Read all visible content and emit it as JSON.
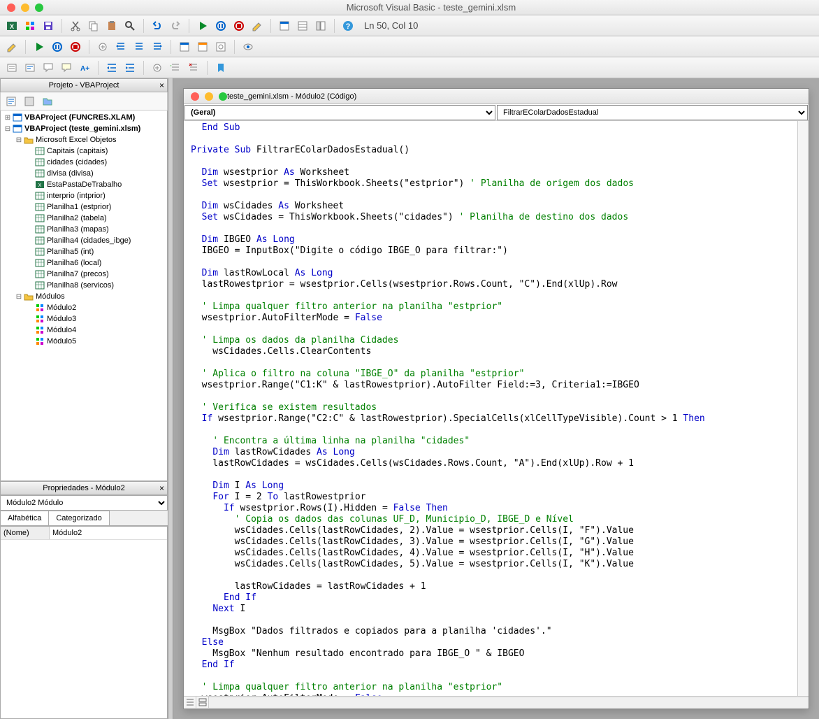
{
  "window_title": "Microsoft Visual Basic - teste_gemini.xlsm",
  "status": "Ln 50, Col 10",
  "project_panel_title": "Projeto - VBAProject",
  "properties_panel_title": "Propriedades - Módulo2",
  "prop_select": "Módulo2 Módulo",
  "prop_tab1": "Alfabética",
  "prop_tab2": "Categorizado",
  "prop_name_label": "(Nome)",
  "prop_name_value": "Módulo2",
  "code_window_title": "teste_gemini.xlsm - Módulo2 (Código)",
  "object_select": "(Geral)",
  "proc_select": "FiltrarEColarDadosEstadual",
  "tree": [
    {
      "d": 0,
      "t": "+",
      "icon": "proj",
      "b": true,
      "label": "VBAProject (FUNCRES.XLAM)"
    },
    {
      "d": 0,
      "t": "-",
      "icon": "proj",
      "b": true,
      "label": "VBAProject (teste_gemini.xlsm)"
    },
    {
      "d": 1,
      "t": "-",
      "icon": "folder",
      "label": "Microsoft Excel Objetos"
    },
    {
      "d": 2,
      "t": "",
      "icon": "sheet",
      "label": "Capitais (capitais)"
    },
    {
      "d": 2,
      "t": "",
      "icon": "sheet",
      "label": "cidades (cidades)"
    },
    {
      "d": 2,
      "t": "",
      "icon": "sheet",
      "label": "divisa (divisa)"
    },
    {
      "d": 2,
      "t": "",
      "icon": "wb",
      "label": "EstaPastaDeTrabalho"
    },
    {
      "d": 2,
      "t": "",
      "icon": "sheet",
      "label": "interprio (intprior)"
    },
    {
      "d": 2,
      "t": "",
      "icon": "sheet",
      "label": "Planilha1 (estprior)"
    },
    {
      "d": 2,
      "t": "",
      "icon": "sheet",
      "label": "Planilha2 (tabela)"
    },
    {
      "d": 2,
      "t": "",
      "icon": "sheet",
      "label": "Planilha3 (mapas)"
    },
    {
      "d": 2,
      "t": "",
      "icon": "sheet",
      "label": "Planilha4 (cidades_ibge)"
    },
    {
      "d": 2,
      "t": "",
      "icon": "sheet",
      "label": "Planilha5 (int)"
    },
    {
      "d": 2,
      "t": "",
      "icon": "sheet",
      "label": "Planilha6 (local)"
    },
    {
      "d": 2,
      "t": "",
      "icon": "sheet",
      "label": "Planilha7 (precos)"
    },
    {
      "d": 2,
      "t": "",
      "icon": "sheet",
      "label": "Planilha8 (servicos)"
    },
    {
      "d": 1,
      "t": "-",
      "icon": "folder",
      "label": "Módulos"
    },
    {
      "d": 2,
      "t": "",
      "icon": "mod",
      "label": "Módulo2"
    },
    {
      "d": 2,
      "t": "",
      "icon": "mod",
      "label": "Módulo3"
    },
    {
      "d": 2,
      "t": "",
      "icon": "mod",
      "label": "Módulo4"
    },
    {
      "d": 2,
      "t": "",
      "icon": "mod",
      "label": "Módulo5"
    }
  ],
  "code_lines": [
    {
      "i": 1,
      "seg": [
        {
          "t": "End Sub",
          "c": "kw"
        }
      ]
    },
    {
      "i": 0,
      "seg": [
        {
          "t": "",
          "c": ""
        }
      ]
    },
    {
      "i": 0,
      "seg": [
        {
          "t": "Private Sub ",
          "c": "kw"
        },
        {
          "t": "FiltrarEColarDadosEstadual()",
          "c": ""
        }
      ]
    },
    {
      "i": 0,
      "seg": [
        {
          "t": "",
          "c": ""
        }
      ]
    },
    {
      "i": 1,
      "seg": [
        {
          "t": "Dim ",
          "c": "kw"
        },
        {
          "t": "wsestprior ",
          "c": ""
        },
        {
          "t": "As ",
          "c": "kw"
        },
        {
          "t": "Worksheet",
          "c": ""
        }
      ]
    },
    {
      "i": 1,
      "seg": [
        {
          "t": "Set ",
          "c": "kw"
        },
        {
          "t": "wsestprior = ThisWorkbook.Sheets(\"estprior\") ",
          "c": ""
        },
        {
          "t": "' Planilha de origem dos dados",
          "c": "cm"
        }
      ]
    },
    {
      "i": 0,
      "seg": [
        {
          "t": "",
          "c": ""
        }
      ]
    },
    {
      "i": 1,
      "seg": [
        {
          "t": "Dim ",
          "c": "kw"
        },
        {
          "t": "wsCidades ",
          "c": ""
        },
        {
          "t": "As ",
          "c": "kw"
        },
        {
          "t": "Worksheet",
          "c": ""
        }
      ]
    },
    {
      "i": 1,
      "seg": [
        {
          "t": "Set ",
          "c": "kw"
        },
        {
          "t": "wsCidades = ThisWorkbook.Sheets(\"cidades\") ",
          "c": ""
        },
        {
          "t": "' Planilha de destino dos dados",
          "c": "cm"
        }
      ]
    },
    {
      "i": 0,
      "seg": [
        {
          "t": "",
          "c": ""
        }
      ]
    },
    {
      "i": 1,
      "seg": [
        {
          "t": "Dim ",
          "c": "kw"
        },
        {
          "t": "IBGEO ",
          "c": ""
        },
        {
          "t": "As Long",
          "c": "kw"
        }
      ]
    },
    {
      "i": 1,
      "seg": [
        {
          "t": "IBGEO = InputBox(\"Digite o código IBGE_O para filtrar:\")",
          "c": ""
        }
      ]
    },
    {
      "i": 0,
      "seg": [
        {
          "t": "",
          "c": ""
        }
      ]
    },
    {
      "i": 1,
      "seg": [
        {
          "t": "Dim ",
          "c": "kw"
        },
        {
          "t": "lastRowLocal ",
          "c": ""
        },
        {
          "t": "As Long",
          "c": "kw"
        }
      ]
    },
    {
      "i": 1,
      "seg": [
        {
          "t": "lastRowestprior = wsestprior.Cells(wsestprior.Rows.Count, \"C\").End(xlUp).Row",
          "c": ""
        }
      ]
    },
    {
      "i": 0,
      "seg": [
        {
          "t": "",
          "c": ""
        }
      ]
    },
    {
      "i": 1,
      "seg": [
        {
          "t": "' Limpa qualquer filtro anterior na planilha \"estprior\"",
          "c": "cm"
        }
      ]
    },
    {
      "i": 1,
      "seg": [
        {
          "t": "wsestprior.AutoFilterMode = ",
          "c": ""
        },
        {
          "t": "False",
          "c": "kw"
        }
      ]
    },
    {
      "i": 0,
      "seg": [
        {
          "t": "",
          "c": ""
        }
      ]
    },
    {
      "i": 1,
      "seg": [
        {
          "t": "' Limpa os dados da planilha Cidades",
          "c": "cm"
        }
      ]
    },
    {
      "i": 2,
      "seg": [
        {
          "t": "wsCidades.Cells.ClearContents",
          "c": ""
        }
      ]
    },
    {
      "i": 0,
      "seg": [
        {
          "t": "",
          "c": ""
        }
      ]
    },
    {
      "i": 1,
      "seg": [
        {
          "t": "' Aplica o filtro na coluna \"IBGE_O\" da planilha \"estprior\"",
          "c": "cm"
        }
      ]
    },
    {
      "i": 1,
      "seg": [
        {
          "t": "wsestprior.Range(\"C1:K\" & lastRowestprior).AutoFilter Field:=3, Criteria1:=IBGEO",
          "c": ""
        }
      ]
    },
    {
      "i": 0,
      "seg": [
        {
          "t": "",
          "c": ""
        }
      ]
    },
    {
      "i": 1,
      "seg": [
        {
          "t": "' Verifica se existem resultados",
          "c": "cm"
        }
      ]
    },
    {
      "i": 1,
      "seg": [
        {
          "t": "If ",
          "c": "kw"
        },
        {
          "t": "wsestprior.Range(\"C2:C\" & lastRowestprior).SpecialCells(xlCellTypeVisible).Count > 1 ",
          "c": ""
        },
        {
          "t": "Then",
          "c": "kw"
        }
      ]
    },
    {
      "i": 0,
      "seg": [
        {
          "t": "",
          "c": ""
        }
      ]
    },
    {
      "i": 2,
      "seg": [
        {
          "t": "' Encontra a última linha na planilha \"cidades\"",
          "c": "cm"
        }
      ]
    },
    {
      "i": 2,
      "seg": [
        {
          "t": "Dim ",
          "c": "kw"
        },
        {
          "t": "lastRowCidades ",
          "c": ""
        },
        {
          "t": "As Long",
          "c": "kw"
        }
      ]
    },
    {
      "i": 2,
      "seg": [
        {
          "t": "lastRowCidades = wsCidades.Cells(wsCidades.Rows.Count, \"A\").End(xlUp).Row + 1",
          "c": ""
        }
      ]
    },
    {
      "i": 0,
      "seg": [
        {
          "t": "",
          "c": ""
        }
      ]
    },
    {
      "i": 2,
      "seg": [
        {
          "t": "Dim ",
          "c": "kw"
        },
        {
          "t": "I ",
          "c": ""
        },
        {
          "t": "As Long",
          "c": "kw"
        }
      ]
    },
    {
      "i": 2,
      "seg": [
        {
          "t": "For ",
          "c": "kw"
        },
        {
          "t": "I = 2 ",
          "c": ""
        },
        {
          "t": "To ",
          "c": "kw"
        },
        {
          "t": "lastRowestprior",
          "c": ""
        }
      ]
    },
    {
      "i": 3,
      "seg": [
        {
          "t": "If ",
          "c": "kw"
        },
        {
          "t": "wsestprior.Rows(I).Hidden = ",
          "c": ""
        },
        {
          "t": "False Then",
          "c": "kw"
        }
      ]
    },
    {
      "i": 4,
      "seg": [
        {
          "t": "' Copia os dados das colunas UF_D, Municipio_D, IBGE_D e Nível",
          "c": "cm"
        }
      ]
    },
    {
      "i": 4,
      "seg": [
        {
          "t": "wsCidades.Cells(lastRowCidades, 2).Value = wsestprior.Cells(I, \"F\").Value",
          "c": ""
        }
      ]
    },
    {
      "i": 4,
      "seg": [
        {
          "t": "wsCidades.Cells(lastRowCidades, 3).Value = wsestprior.Cells(I, \"G\").Value",
          "c": ""
        }
      ]
    },
    {
      "i": 4,
      "seg": [
        {
          "t": "wsCidades.Cells(lastRowCidades, 4).Value = wsestprior.Cells(I, \"H\").Value",
          "c": ""
        }
      ]
    },
    {
      "i": 4,
      "seg": [
        {
          "t": "wsCidades.Cells(lastRowCidades, 5).Value = wsestprior.Cells(I, \"K\").Value",
          "c": ""
        }
      ]
    },
    {
      "i": 0,
      "seg": [
        {
          "t": "",
          "c": ""
        }
      ]
    },
    {
      "i": 4,
      "seg": [
        {
          "t": "lastRowCidades = lastRowCidades + 1",
          "c": ""
        }
      ]
    },
    {
      "i": 3,
      "seg": [
        {
          "t": "End If",
          "c": "kw"
        }
      ]
    },
    {
      "i": 2,
      "seg": [
        {
          "t": "Next ",
          "c": "kw"
        },
        {
          "t": "I",
          "c": ""
        }
      ]
    },
    {
      "i": 0,
      "seg": [
        {
          "t": "",
          "c": ""
        }
      ]
    },
    {
      "i": 2,
      "seg": [
        {
          "t": "MsgBox \"Dados filtrados e copiados para a planilha 'cidades'.\"",
          "c": ""
        }
      ]
    },
    {
      "i": 1,
      "seg": [
        {
          "t": "Else",
          "c": "kw"
        }
      ]
    },
    {
      "i": 2,
      "seg": [
        {
          "t": "MsgBox \"Nenhum resultado encontrado para IBGE_O \" & IBGEO",
          "c": ""
        }
      ]
    },
    {
      "i": 1,
      "seg": [
        {
          "t": "End If",
          "c": "kw"
        }
      ]
    },
    {
      "i": 0,
      "seg": [
        {
          "t": "",
          "c": ""
        }
      ]
    },
    {
      "i": 1,
      "seg": [
        {
          "t": "' Limpa qualquer filtro anterior na planilha \"estprior\"",
          "c": "cm"
        }
      ]
    },
    {
      "i": 1,
      "seg": [
        {
          "t": "wsestprior.AutoFilterMode = ",
          "c": ""
        },
        {
          "t": "False",
          "c": "kw"
        }
      ]
    }
  ]
}
